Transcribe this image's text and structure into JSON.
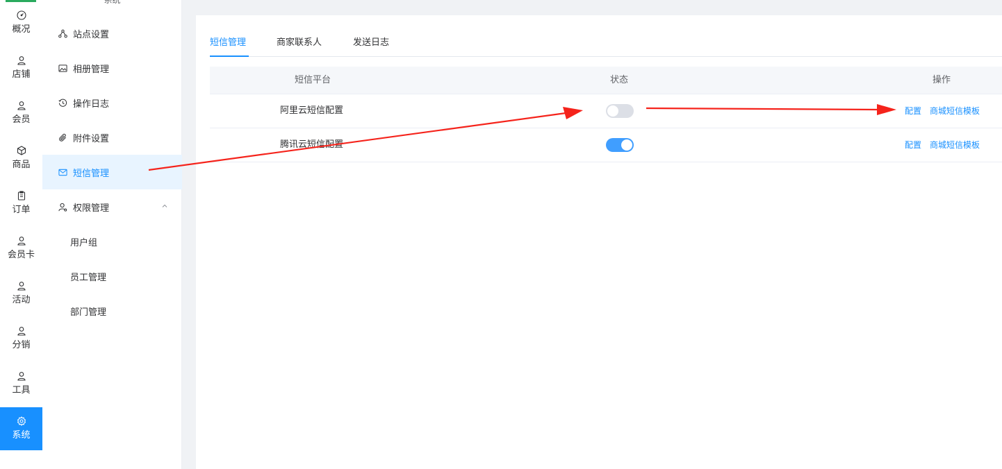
{
  "colors": {
    "accent": "#1890ff",
    "arrow": "#f5231b",
    "switch_on": "#409eff",
    "switch_off": "#dcdfe6"
  },
  "nav": {
    "items": [
      {
        "label": "概况",
        "icon": "dashboard-icon"
      },
      {
        "label": "店铺",
        "icon": "user-icon"
      },
      {
        "label": "会员",
        "icon": "user-icon"
      },
      {
        "label": "商品",
        "icon": "cube-icon"
      },
      {
        "label": "订单",
        "icon": "clipboard-icon"
      },
      {
        "label": "会员卡",
        "icon": "user-icon"
      },
      {
        "label": "活动",
        "icon": "user-icon"
      },
      {
        "label": "分销",
        "icon": "user-icon"
      },
      {
        "label": "工具",
        "icon": "user-icon"
      },
      {
        "label": "系统",
        "icon": "gear-icon",
        "active": true
      }
    ]
  },
  "submenu": {
    "header": "系统",
    "items": [
      {
        "label": "站点设置",
        "icon": "sitemap-icon"
      },
      {
        "label": "相册管理",
        "icon": "image-icon"
      },
      {
        "label": "操作日志",
        "icon": "history-icon"
      },
      {
        "label": "附件设置",
        "icon": "paperclip-icon"
      },
      {
        "label": "短信管理",
        "icon": "mail-icon",
        "active": true
      },
      {
        "label": "权限管理",
        "icon": "user-settings-icon",
        "expanded": true
      }
    ],
    "children": [
      {
        "label": "用户组"
      },
      {
        "label": "员工管理"
      },
      {
        "label": "部门管理"
      }
    ]
  },
  "tabs": [
    {
      "label": "短信管理",
      "active": true
    },
    {
      "label": "商家联系人"
    },
    {
      "label": "发送日志"
    }
  ],
  "table": {
    "headers": {
      "platform": "短信平台",
      "status": "状态",
      "action": "操作"
    },
    "rows": [
      {
        "name": "阿里云短信配置",
        "enabled": false,
        "config_label": "配置",
        "template_label": "商城短信模板"
      },
      {
        "name": "腾讯云短信配置",
        "enabled": true,
        "config_label": "配置",
        "template_label": "商城短信模板"
      }
    ]
  }
}
